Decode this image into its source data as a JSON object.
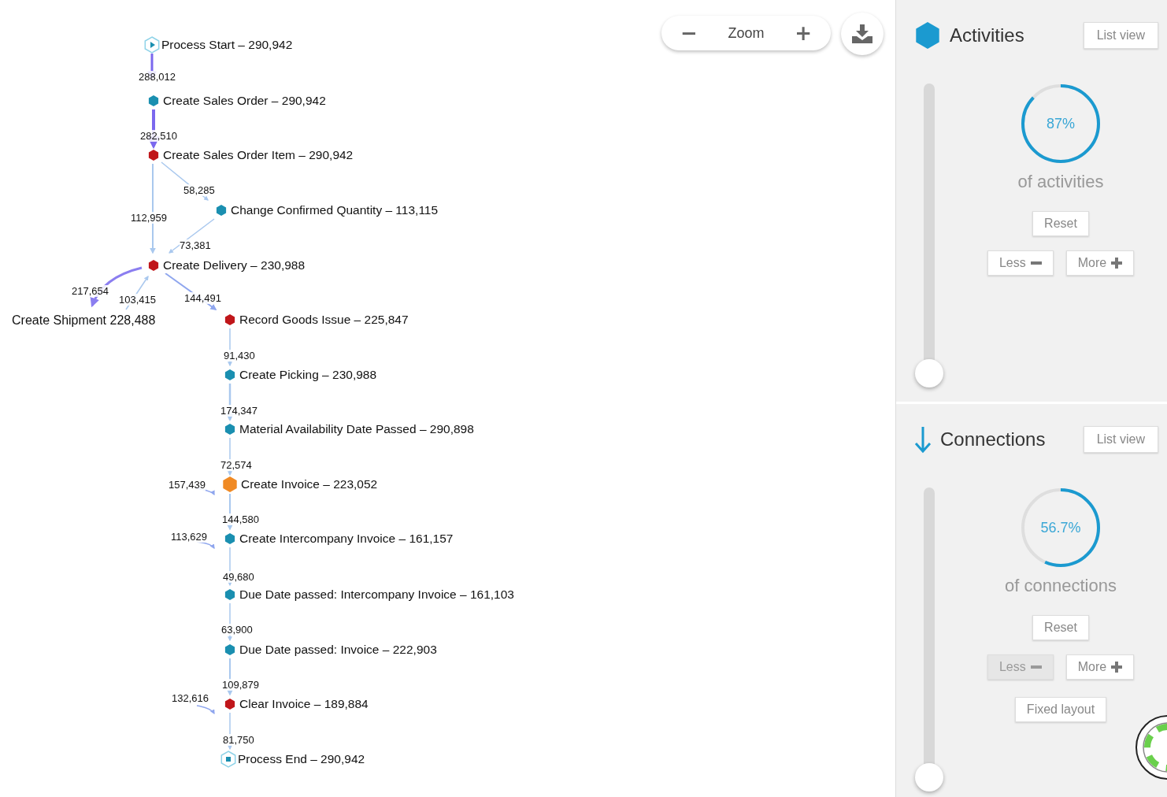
{
  "zoom_control": {
    "label": "Zoom",
    "minus": "−",
    "plus": "+"
  },
  "nodes": [
    {
      "kind": "start",
      "label": "Process Start – 290,942"
    },
    {
      "kind": "activity",
      "label": "Create Sales Order – 290,942",
      "color": "#1a8fb0"
    },
    {
      "kind": "activity",
      "label": "Create Sales Order Item – 290,942",
      "color": "#c0161a"
    },
    {
      "kind": "activity",
      "label": "Change Confirmed Quantity – 113,115",
      "color": "#1a8fb0"
    },
    {
      "kind": "activity",
      "label": "Create Delivery – 230,988",
      "color": "#c0161a"
    },
    {
      "kind": "plain",
      "label": "Create Shipment 228,488"
    },
    {
      "kind": "activity",
      "label": "Record Goods Issue – 225,847",
      "color": "#c0161a"
    },
    {
      "kind": "activity",
      "label": "Create Picking – 230,988",
      "color": "#1a8fb0"
    },
    {
      "kind": "activity",
      "label": "Material Availability Date Passed – 290,898",
      "color": "#1a8fb0"
    },
    {
      "kind": "activity",
      "label": "Create Invoice – 223,052",
      "color": "#f08a24"
    },
    {
      "kind": "activity",
      "label": "Create Intercompany Invoice – 161,157",
      "color": "#1a8fb0"
    },
    {
      "kind": "activity",
      "label": "Due Date passed: Intercompany Invoice – 161,103",
      "color": "#1a8fb0"
    },
    {
      "kind": "activity",
      "label": "Due Date passed: Invoice – 222,903",
      "color": "#1a8fb0"
    },
    {
      "kind": "activity",
      "label": "Clear Invoice – 189,884",
      "color": "#c0161a"
    },
    {
      "kind": "end",
      "label": "Process End – 290,942"
    }
  ],
  "edges": [
    {
      "label": "288,012"
    },
    {
      "label": "282,510"
    },
    {
      "label": "58,285"
    },
    {
      "label": "112,959"
    },
    {
      "label": "73,381"
    },
    {
      "label": "217,654"
    },
    {
      "label": "103,415"
    },
    {
      "label": "144,491"
    },
    {
      "label": "91,430"
    },
    {
      "label": "174,347"
    },
    {
      "label": "72,574"
    },
    {
      "label": "157,439"
    },
    {
      "label": "144,580"
    },
    {
      "label": "113,629"
    },
    {
      "label": "49,680"
    },
    {
      "label": "63,900"
    },
    {
      "label": "109,879"
    },
    {
      "label": "132,616"
    },
    {
      "label": "81,750"
    }
  ],
  "panels": [
    {
      "kind": "activities",
      "title": "Activities",
      "list_view": "List view",
      "slider": {
        "level": 0
      },
      "gauge": {
        "value": "87%",
        "caption": "of activities"
      },
      "reset": "Reset",
      "less": {
        "label": "Less",
        "disabled": false
      },
      "more": {
        "label": "More",
        "disabled": false
      }
    },
    {
      "kind": "connections",
      "title": "Connections",
      "list_view": "List view",
      "slider": {
        "level": 0
      },
      "gauge": {
        "value": "56.7%",
        "caption": "of connections"
      },
      "reset": "Reset",
      "less": {
        "label": "Less",
        "disabled": true
      },
      "more": {
        "label": "More",
        "disabled": false
      },
      "fixed_layout": "Fixed layout"
    }
  ]
}
